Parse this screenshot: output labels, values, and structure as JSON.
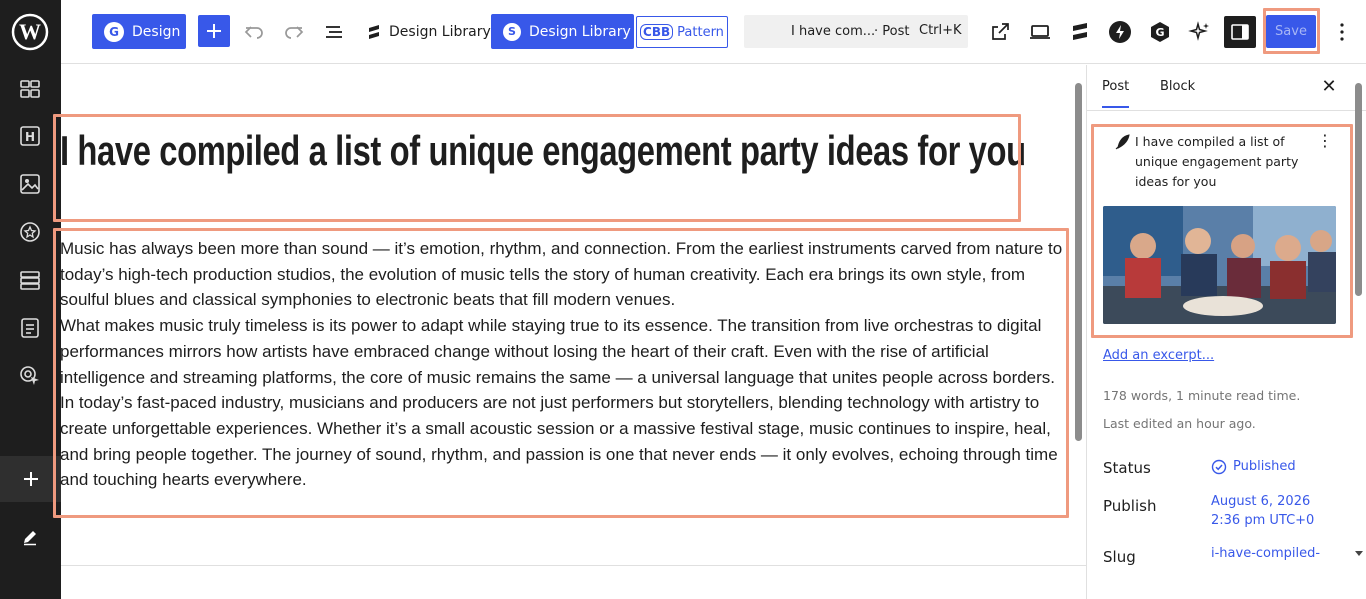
{
  "toolbar": {
    "design_label": "Design",
    "design_library_label": "Design Library",
    "design_library_button_label": "Design Library",
    "cbb_tag": "CBB",
    "pattern_label": "Pattern",
    "command_title": "I have com...",
    "command_type": "· Post",
    "command_shortcut": "Ctrl+K",
    "save_label": "Save"
  },
  "post": {
    "title": "I have compiled a list of unique engagement party ideas for you",
    "paragraphs": [
      "Music has always been more than sound — it’s emotion, rhythm, and connection. From the earliest instruments carved from nature to today’s high-tech production studios, the evolution of music tells the story of human creativity. Each era brings its own style, from soulful blues and classical symphonies to electronic beats that fill modern venues.",
      "What makes music truly timeless is its power to adapt while staying true to its essence. The transition from live orchestras to digital performances mirrors how artists have embraced change without losing the heart of their craft. Even with the rise of artificial intelligence and streaming platforms, the core of music remains the same — a universal language that unites people across borders.",
      "In today’s fast-paced industry, musicians and producers are not just performers but storytellers, blending technology with artistry to create unforgettable experiences. Whether it’s a small acoustic session or a massive festival stage, music continues to inspire, heal, and bring people together. The journey of sound, rhythm, and passion is one that never ends — it only evolves, echoing through time and touching hearts everywhere."
    ]
  },
  "sidebar": {
    "tabs": [
      "Post",
      "Block"
    ],
    "card_title": "I have compiled a list of unique engagement party ideas for you",
    "excerpt_link": "Add an excerpt...",
    "word_count": "178 words, 1 minute read time.",
    "last_edited": "Last edited an hour ago.",
    "status_label": "Status",
    "status_value": "Published",
    "publish_label": "Publish",
    "publish_date": "August 6, 2026",
    "publish_time": "2:36 pm UTC+0",
    "slug_label": "Slug",
    "slug_value": "i-have-compiled-"
  },
  "colors": {
    "accent": "#3858e9",
    "rail": "#1e1e1e",
    "highlight": "#ef9a7f"
  },
  "icons": {
    "rail": [
      "wordpress-logo-icon",
      "patterns-icon",
      "heading-icon",
      "image-icon",
      "star-icon",
      "stack-icon",
      "form-icon",
      "pointer-icon",
      "add-icon",
      "pencil-icon"
    ],
    "toolbar": [
      "undo-icon",
      "redo-icon",
      "list-view-icon",
      "external-link-icon",
      "desktop-preview-icon",
      "stackable-icon",
      "bolt-icon",
      "g-icon",
      "sparkle-icon",
      "sidebar-toggle-icon",
      "more-vertical-icon"
    ]
  }
}
